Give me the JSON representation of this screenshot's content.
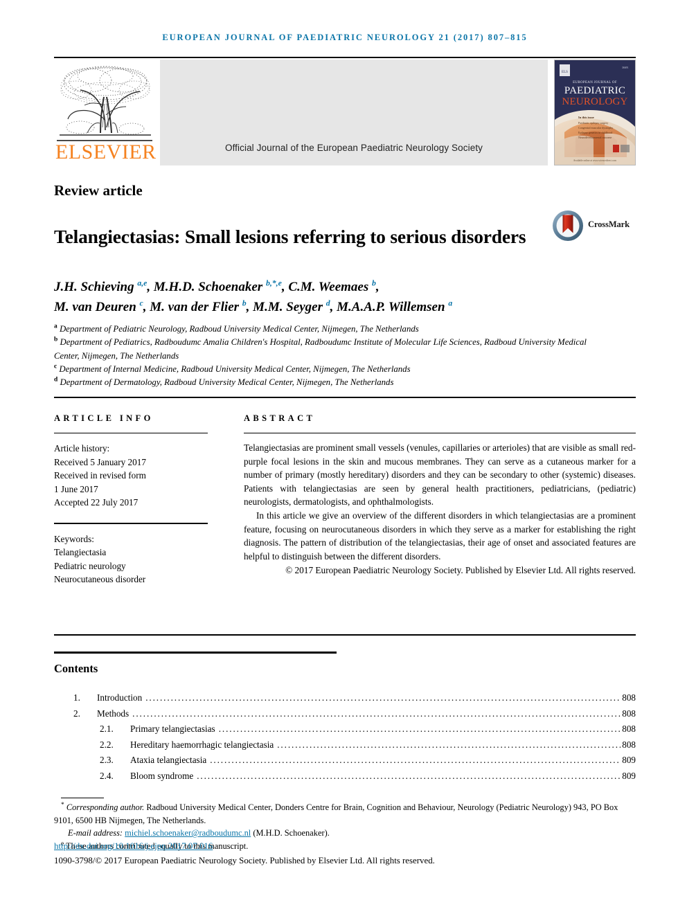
{
  "running_head": "EUROPEAN JOURNAL OF PAEDIATRIC NEUROLOGY 21 (2017) 807–815",
  "masthead": {
    "publisher_name": "ELSEVIER",
    "banner_text": "Official Journal of the European Paediatric Neurology Society",
    "cover": {
      "line1": "EUROPEAN JOURNAL OF",
      "line2": "PAEDIATRIC",
      "line3": "NEUROLOGY",
      "inside_label": "In this issue",
      "footer_note": "Available online at www.sciencedirect.com"
    }
  },
  "article": {
    "type": "Review article",
    "title": "Telangiectasias: Small lesions referring to serious disorders",
    "crossmark_label": "CrossMark",
    "authors_line1_parts": [
      {
        "name": "J.H. Schieving",
        "sup": "a,e"
      },
      {
        "name": "M.H.D. Schoenaker",
        "sup": "b,*,e"
      },
      {
        "name": "C.M. Weemaes",
        "sup": "b"
      }
    ],
    "authors_line2_parts": [
      {
        "name": "M. van Deuren",
        "sup": "c"
      },
      {
        "name": "M. van der Flier",
        "sup": "b"
      },
      {
        "name": "M.M. Seyger",
        "sup": "d"
      },
      {
        "name": "M.A.A.P. Willemsen",
        "sup": "a"
      }
    ],
    "affiliations": [
      {
        "mark": "a",
        "text": "Department of Pediatric Neurology, Radboud University Medical Center, Nijmegen, The Netherlands"
      },
      {
        "mark": "b",
        "text": "Department of Pediatrics, Radboudumc Amalia Children's Hospital, Radboudumc Institute of Molecular Life Sciences, Radboud University Medical Center, Nijmegen, The Netherlands"
      },
      {
        "mark": "c",
        "text": "Department of Internal Medicine, Radboud University Medical Center, Nijmegen, The Netherlands"
      },
      {
        "mark": "d",
        "text": "Department of Dermatology, Radboud University Medical Center, Nijmegen, The Netherlands"
      }
    ]
  },
  "article_info": {
    "heading": "ARTICLE INFO",
    "history_label": "Article history:",
    "history": [
      "Received 5 January 2017",
      "Received in revised form",
      "1 June 2017",
      "Accepted 22 July 2017"
    ],
    "keywords_label": "Keywords:",
    "keywords": [
      "Telangiectasia",
      "Pediatric neurology",
      "Neurocutaneous disorder"
    ]
  },
  "abstract": {
    "heading": "ABSTRACT",
    "paragraph1": "Telangiectasias are prominent small vessels (venules, capillaries or arterioles) that are visible as small red-purple focal lesions in the skin and mucous membranes. They can serve as a cutaneous marker for a number of primary (mostly hereditary) disorders and they can be secondary to other (systemic) diseases. Patients with telangiectasias are seen by general health practitioners, pediatricians, (pediatric) neurologists, dermatologists, and ophthalmologists.",
    "paragraph2": "In this article we give an overview of the different disorders in which telangiectasias are a prominent feature, focusing on neurocutaneous disorders in which they serve as a marker for establishing the right diagnosis. The pattern of distribution of the telangiectasias, their age of onset and associated features are helpful to distinguish between the different disorders.",
    "copyright": "© 2017 European Paediatric Neurology Society. Published by Elsevier Ltd. All rights reserved."
  },
  "contents": {
    "heading": "Contents",
    "entries": [
      {
        "num": "1.",
        "label": "Introduction",
        "page": "808",
        "level": 1
      },
      {
        "num": "2.",
        "label": "Methods",
        "page": "808",
        "level": 1
      },
      {
        "num": "2.1.",
        "label": "Primary telangiectasias",
        "page": "808",
        "level": 2
      },
      {
        "num": "2.2.",
        "label": "Hereditary haemorrhagic telangiectasia",
        "page": "808",
        "level": 2
      },
      {
        "num": "2.3.",
        "label": "Ataxia telangiectasia",
        "page": "809",
        "level": 2
      },
      {
        "num": "2.4.",
        "label": "Bloom syndrome",
        "page": "809",
        "level": 2
      }
    ]
  },
  "footer": {
    "corresponding_mark": "*",
    "corresponding_label": "Corresponding author.",
    "corresponding_text": " Radboud University Medical Center, Donders Centre for Brain, Cognition and Behaviour, Neurology (Pediatric Neurology) 943, PO Box 9101, 6500 HB Nijmegen, The Netherlands.",
    "email_label": "E-mail address:",
    "email": "michiel.schoenaker@radboudumc.nl",
    "email_suffix": "(M.H.D. Schoenaker).",
    "equal_mark": "e",
    "equal_contrib": "These authors contributed equally to this manuscript.",
    "doi": "http://dx.doi.org/10.1016/j.ejpn.2017.07.016",
    "issn_line": "1090-3798/© 2017 European Paediatric Neurology Society. Published by Elsevier Ltd. All rights reserved."
  },
  "colors": {
    "accent_blue": "#0b75a8",
    "elsevier_orange": "#f58220",
    "banner_gray": "#e6e6e6",
    "cover_navy": "#2b2f55",
    "crossmark_red": "#c0261b"
  }
}
